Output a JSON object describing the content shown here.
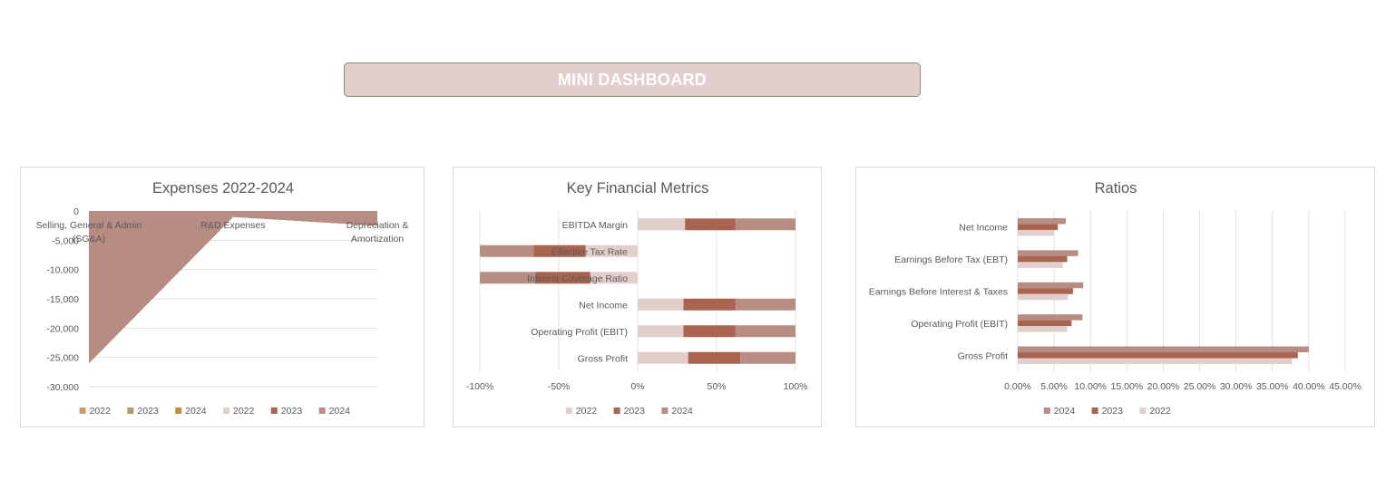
{
  "dashboard": {
    "title": "MINI DASHBOARD"
  },
  "chart_data": [
    {
      "type": "area",
      "title": "Expenses 2022-2024",
      "categories": [
        "Selling, General & Admin (SG&A)",
        "R&D Expenses",
        "Depreciation & Amortization"
      ],
      "series": [
        {
          "name": "2022",
          "values": [
            -26000,
            -1000,
            -2500
          ],
          "color": "#c4a06a"
        },
        {
          "name": "2023",
          "values": [
            -26000,
            -1000,
            -2500
          ],
          "color": "#a89a73"
        },
        {
          "name": "2024",
          "values": [
            -26000,
            -1000,
            -2500
          ],
          "color": "#c58f3d"
        },
        {
          "name": "2022",
          "values": [
            -26000,
            -1000,
            -2500
          ],
          "color": "#e2cfcb"
        },
        {
          "name": "2023",
          "values": [
            -26000,
            -1000,
            -2500
          ],
          "color": "#a8644f"
        },
        {
          "name": "2024",
          "values": [
            -26000,
            -1000,
            -2500
          ],
          "color": "#b78d83"
        }
      ],
      "ylim": [
        -30000,
        0
      ],
      "yticks": [
        "0",
        "-5,000",
        "-10,000",
        "-15,000",
        "-20,000",
        "-25,000",
        "-30,000"
      ],
      "grid": true,
      "legend": "bottom"
    },
    {
      "type": "bar",
      "orientation": "horizontal",
      "stacked": "percent",
      "title": "Key Financial Metrics",
      "categories": [
        "EBITDA Margin",
        "Effective Tax Rate",
        "Interest Coverage Ratio",
        "Net Income",
        "Operating Profit (EBIT)",
        "Gross Profit"
      ],
      "series": [
        {
          "name": "2022",
          "values": [
            30,
            -33,
            -30,
            29,
            29,
            32
          ],
          "color": "#e2cfcb"
        },
        {
          "name": "2023",
          "values": [
            32,
            -33,
            -35,
            33,
            33,
            33
          ],
          "color": "#a8644f"
        },
        {
          "name": "2024",
          "values": [
            38,
            -34,
            -35,
            38,
            38,
            35
          ],
          "color": "#b78d83"
        }
      ],
      "xlim": [
        -100,
        100
      ],
      "xticks": [
        "-100%",
        "-50%",
        "0%",
        "50%",
        "100%"
      ],
      "grid": true,
      "legend": "bottom"
    },
    {
      "type": "bar",
      "orientation": "horizontal",
      "title": "Ratios",
      "categories": [
        "Net Income",
        "Earnings Before Tax (EBT)",
        "Earnings Before Interest & Taxes",
        "Operating Profit (EBIT)",
        "Gross Profit"
      ],
      "series": [
        {
          "name": "2024",
          "values": [
            6.6,
            8.3,
            9.0,
            8.9,
            40.0
          ],
          "color": "#b78d83"
        },
        {
          "name": "2023",
          "values": [
            5.5,
            6.8,
            7.6,
            7.4,
            38.5
          ],
          "color": "#a8644f"
        },
        {
          "name": "2022",
          "values": [
            5.0,
            6.2,
            6.9,
            6.8,
            37.7
          ],
          "color": "#e2cfcb"
        }
      ],
      "xlim": [
        0,
        45
      ],
      "xticks": [
        "0.00%",
        "5.00%",
        "10.00%",
        "15.00%",
        "20.00%",
        "25.00%",
        "30.00%",
        "35.00%",
        "40.00%",
        "45.00%"
      ],
      "grid": true,
      "legend": "bottom"
    }
  ]
}
